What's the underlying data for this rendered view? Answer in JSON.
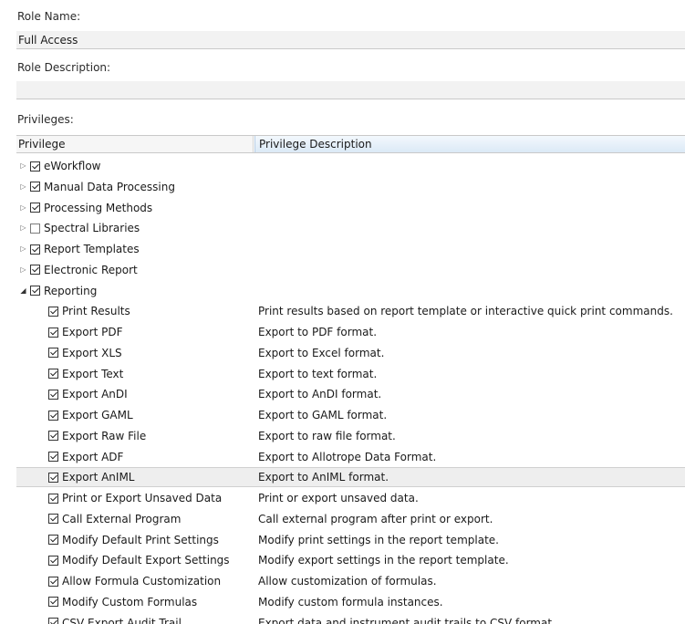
{
  "role_name": {
    "label": "Role Name:",
    "value": "Full Access"
  },
  "role_description": {
    "label": "Role Description:",
    "value": ""
  },
  "privileges": {
    "label": "Privileges:",
    "columns": {
      "privilege": "Privilege",
      "description": "Privilege Description"
    },
    "groups": [
      {
        "label": "eWorkflow",
        "checked": true,
        "expanded": false
      },
      {
        "label": "Manual Data Processing",
        "checked": true,
        "expanded": false
      },
      {
        "label": "Processing Methods",
        "checked": true,
        "expanded": false
      },
      {
        "label": "Spectral Libraries",
        "checked": false,
        "expanded": false
      },
      {
        "label": "Report Templates",
        "checked": true,
        "expanded": false
      },
      {
        "label": "Electronic Report",
        "checked": true,
        "expanded": false
      },
      {
        "label": "Reporting",
        "checked": true,
        "expanded": true
      }
    ],
    "reporting_items": [
      {
        "label": "Print Results",
        "description": "Print results based on report template or interactive quick print commands.",
        "checked": true
      },
      {
        "label": "Export PDF",
        "description": "Export to PDF format.",
        "checked": true
      },
      {
        "label": "Export XLS",
        "description": "Export to Excel format.",
        "checked": true
      },
      {
        "label": "Export Text",
        "description": "Export to text format.",
        "checked": true
      },
      {
        "label": "Export AnDI",
        "description": "Export to AnDI format.",
        "checked": true
      },
      {
        "label": "Export GAML",
        "description": "Export to GAML format.",
        "checked": true
      },
      {
        "label": "Export Raw File",
        "description": "Export to raw file format.",
        "checked": true
      },
      {
        "label": "Export ADF",
        "description": "Export to Allotrope Data Format.",
        "checked": true
      },
      {
        "label": "Export AnIML",
        "description": "Export to AnIML format.",
        "checked": true,
        "selected": true
      },
      {
        "label": "Print or Export Unsaved Data",
        "description": "Print or export unsaved data.",
        "checked": true
      },
      {
        "label": "Call External Program",
        "description": "Call external program after print or export.",
        "checked": true
      },
      {
        "label": "Modify Default Print Settings",
        "description": "Modify print settings in the report template.",
        "checked": true
      },
      {
        "label": "Modify Default Export Settings",
        "description": "Modify export settings in the report template.",
        "checked": true
      },
      {
        "label": "Allow Formula Customization",
        "description": "Allow customization of formulas.",
        "checked": true
      },
      {
        "label": "Modify Custom Formulas",
        "description": "Modify custom formula instances.",
        "checked": true
      },
      {
        "label": "CSV Export Audit Trail",
        "description": "Export data and instrument audit trails to CSV format.",
        "checked": true
      }
    ]
  }
}
